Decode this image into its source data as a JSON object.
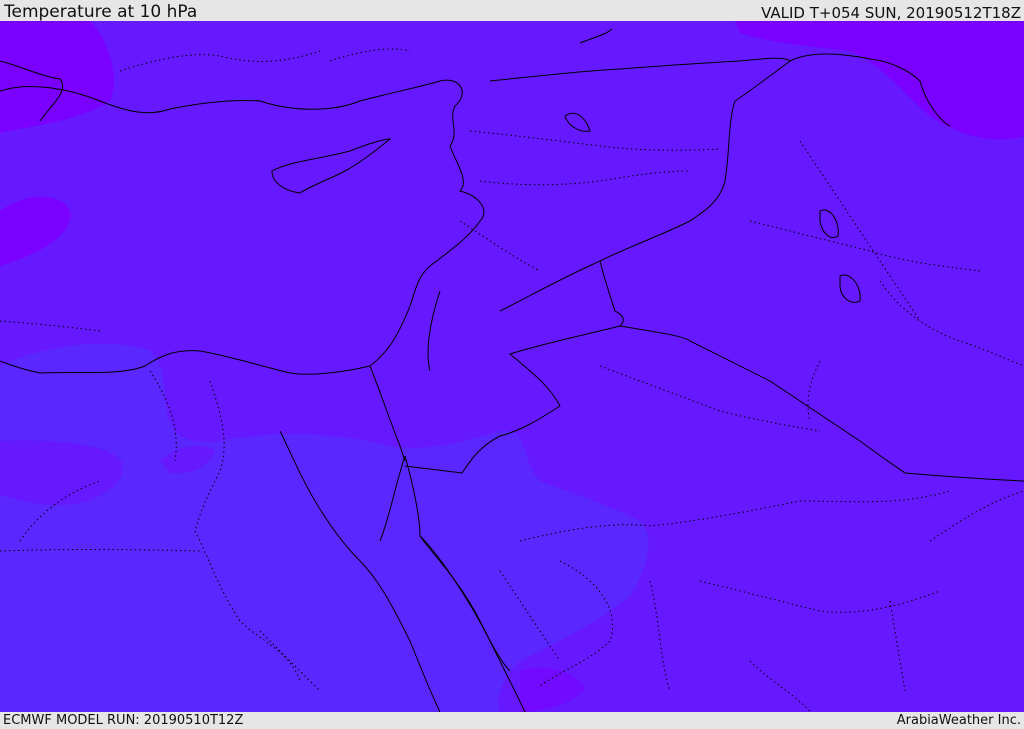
{
  "header": {
    "title": "Temperature at 10 hPa",
    "valid": "VALID T+054 SUN, 20190512T18Z"
  },
  "footer": {
    "model_run": "ECMWF MODEL RUN: 20190510T12Z",
    "brand": "ArabiaWeather Inc."
  },
  "map": {
    "colors": {
      "main_field": "#6619ff",
      "colder_field": "#5a27ff",
      "warmer_field": "#7a00ff",
      "borders": "#000000"
    }
  }
}
